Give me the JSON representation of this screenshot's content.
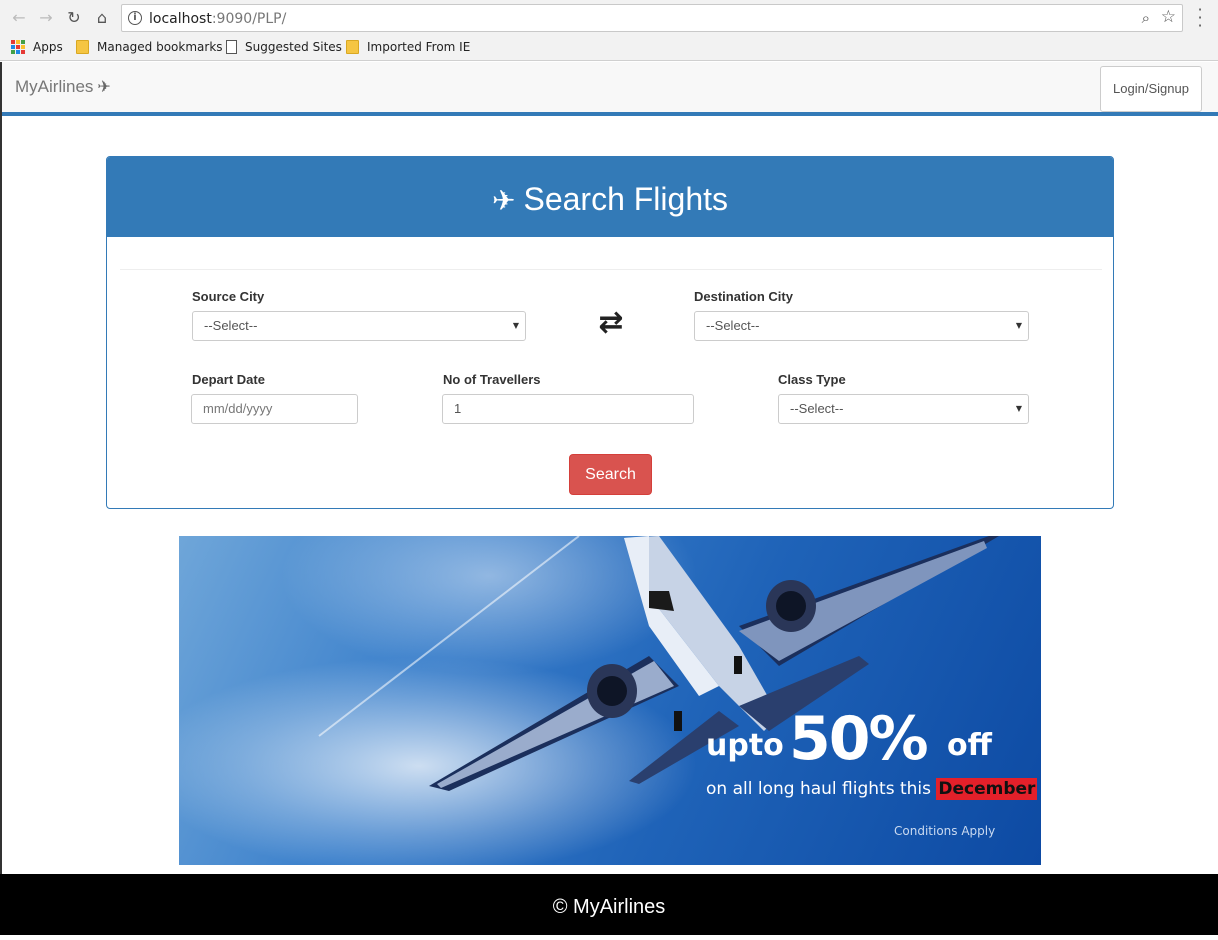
{
  "browser": {
    "url_host": "localhost",
    "url_rest": ":9090/PLP/",
    "bookmarks": [
      {
        "label": "Apps",
        "icon": "apps-grid-icon"
      },
      {
        "label": "Managed bookmarks",
        "icon": "folder-icon"
      },
      {
        "label": "Suggested Sites",
        "icon": "page-icon"
      },
      {
        "label": "Imported From IE",
        "icon": "folder-icon"
      }
    ]
  },
  "navbar": {
    "brand": "MyAirlines",
    "login_label": "Login/Signup"
  },
  "search_panel": {
    "title": "Search Flights",
    "source_label": "Source City",
    "source_value": "--Select--",
    "destination_label": "Destination City",
    "destination_value": "--Select--",
    "depart_label": "Depart Date",
    "depart_placeholder": "mm/dd/yyyy",
    "travellers_label": "No of Travellers",
    "travellers_value": "1",
    "class_label": "Class Type",
    "class_value": "--Select--",
    "search_label": "Search"
  },
  "banner": {
    "upto": "upto",
    "percent": "50%",
    "off": "off",
    "line_main": "on all long haul flights this",
    "line_highlight": "December",
    "conditions": "Conditions Apply"
  },
  "footer": {
    "text": "© MyAirlines"
  },
  "colors": {
    "primary": "#337ab7",
    "danger": "#d9534f",
    "footer_bg": "#000000"
  }
}
